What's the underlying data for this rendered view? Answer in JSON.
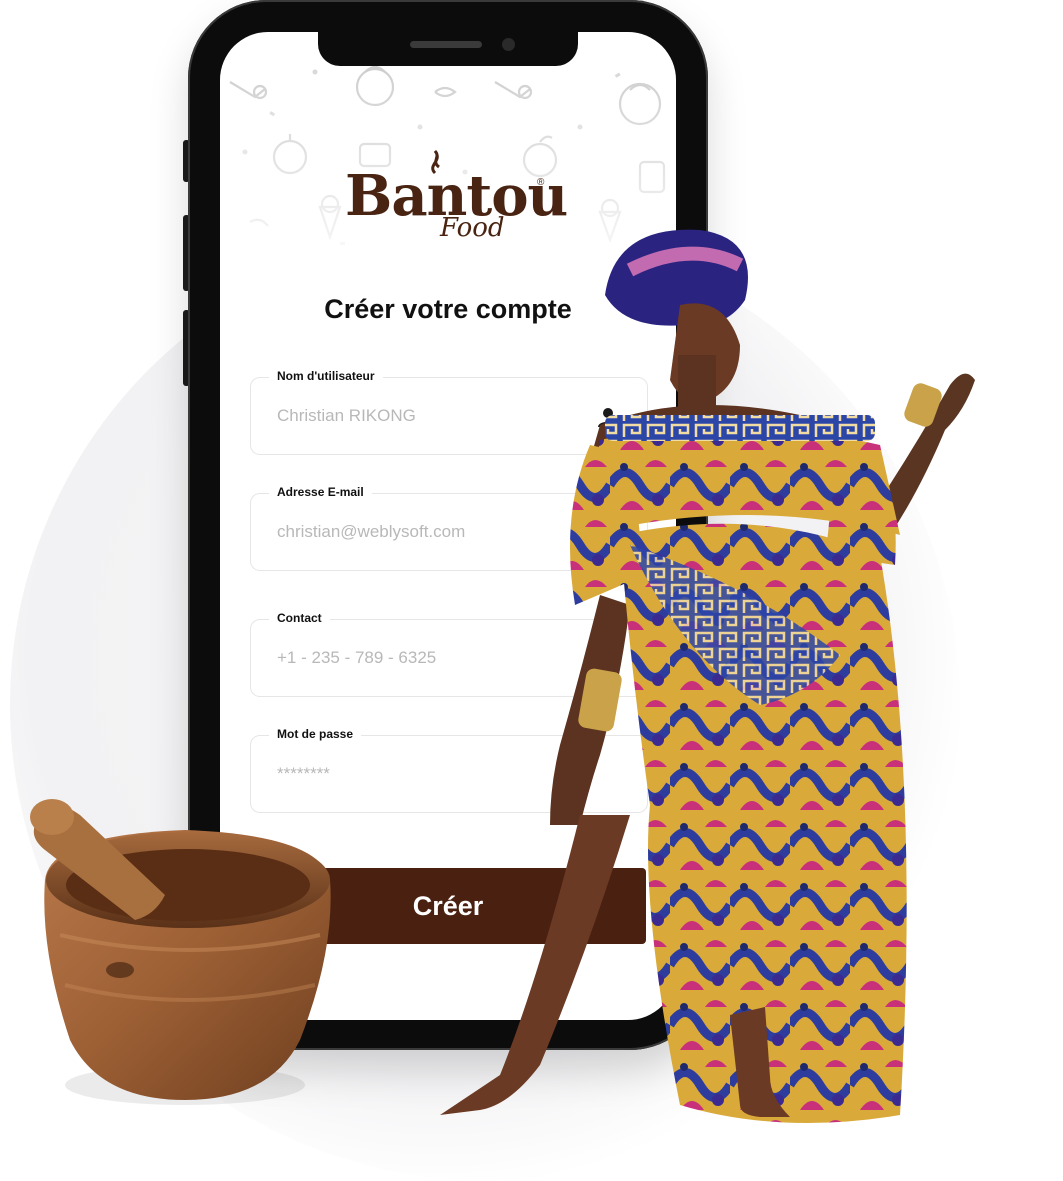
{
  "brand": {
    "logo_word": "Bantou",
    "logo_sub": "Food",
    "registered": "®",
    "primary_color": "#4a2010"
  },
  "form": {
    "title": "Créer votre compte",
    "fields": [
      {
        "label": "Nom d'utilisateur",
        "placeholder": "Christian RIKONG",
        "icon": "user-icon"
      },
      {
        "label": "Adresse E-mail",
        "placeholder": "christian@weblysoft.com"
      },
      {
        "label": "Contact",
        "placeholder": "+1 - 235 - 789 - 6325"
      },
      {
        "label": "Mot de passe",
        "placeholder": "********",
        "icon": "eye-slash-icon"
      }
    ],
    "submit_label": "Créer"
  }
}
